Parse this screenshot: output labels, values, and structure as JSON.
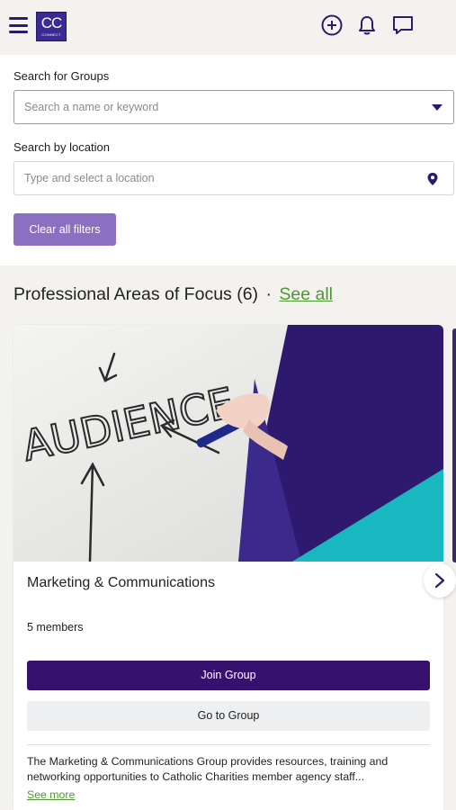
{
  "header": {
    "logo_text": "CC",
    "logo_subtext": "CONNECT",
    "icons": [
      "menu-icon",
      "add-circle-icon",
      "bell-icon",
      "chat-icon"
    ]
  },
  "filters": {
    "group_search_label": "Search for Groups",
    "group_search_placeholder": "Search a name or keyword",
    "location_label": "Search by location",
    "location_placeholder": "Type and select a location",
    "clear_button": "Clear all filters"
  },
  "section": {
    "title": "Professional Areas of Focus (6)",
    "separator": "·",
    "see_all": "See all"
  },
  "card": {
    "image_text": "AUDIENCE",
    "title": "Marketing & Communications",
    "members": "5 members",
    "join_button": "Join Group",
    "go_button": "Go to Group",
    "description": "The Marketing & Communications Group provides resources, training and networking opportunities to Catholic Charities member agency staff...",
    "see_more": "See more"
  },
  "colors": {
    "brand_purple": "#36126e",
    "clear_button": "#8b6fc0",
    "link_green": "#4a9a2e",
    "accent_teal": "#19b8c0"
  }
}
